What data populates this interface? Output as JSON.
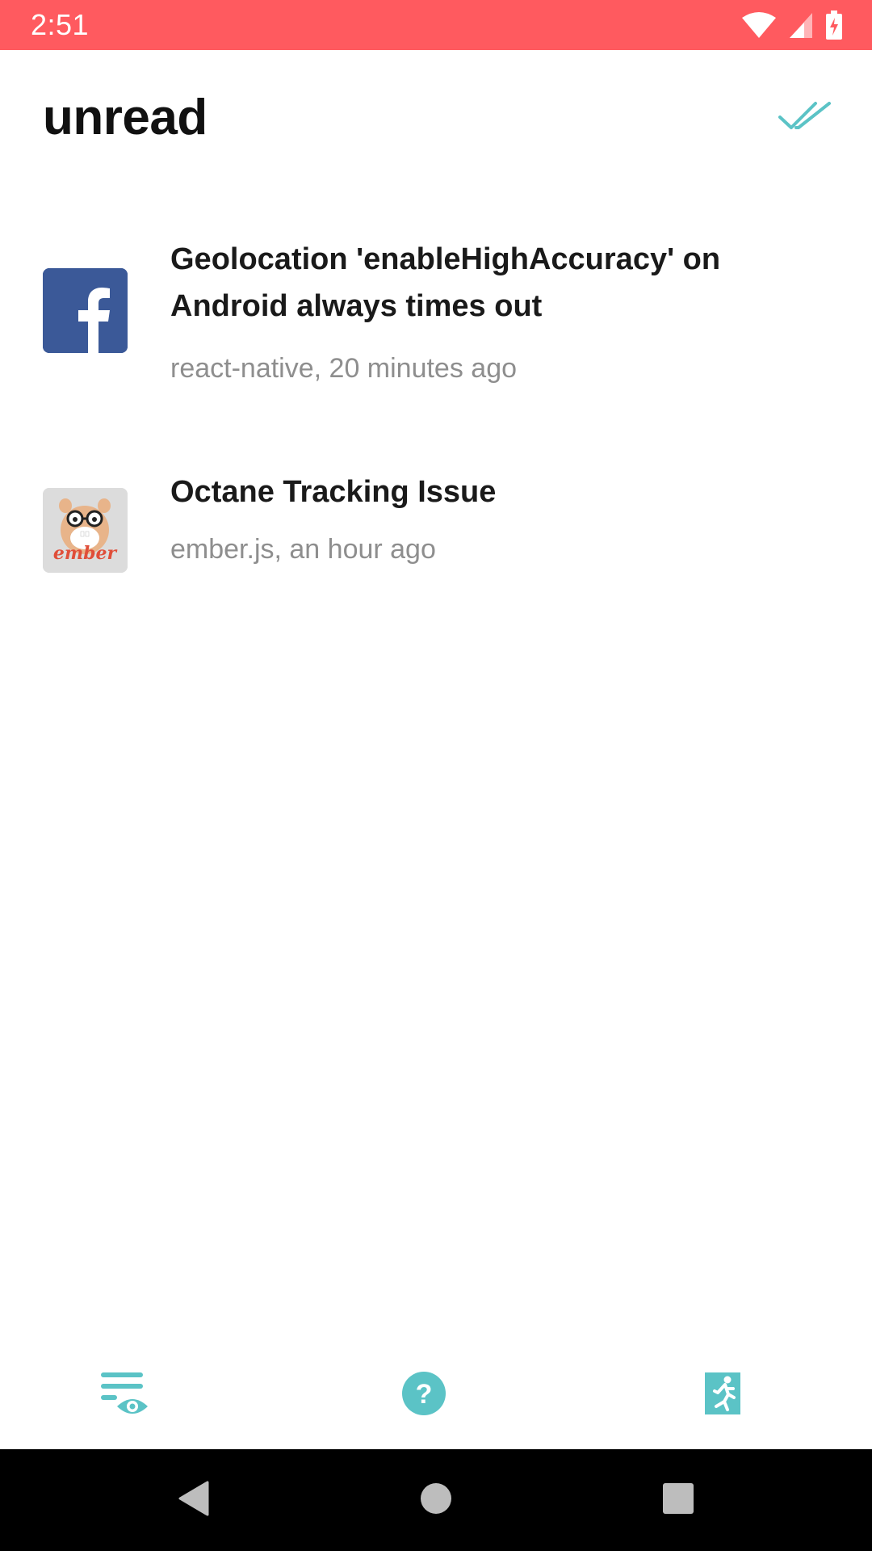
{
  "status_bar": {
    "time": "2:51",
    "icons": [
      "wifi-icon",
      "cell-signal-icon",
      "battery-charging-icon"
    ],
    "color": "#ff5a5f"
  },
  "header": {
    "title": "unread",
    "action_icon": "double-check-icon"
  },
  "notifications": [
    {
      "title": "Geolocation 'enableHighAccuracy' on Android always times out",
      "meta": "react-native, 20 minutes ago",
      "avatar": "facebook-logo"
    },
    {
      "title": "Octane Tracking Issue",
      "meta": "ember.js, an hour ago",
      "avatar": "ember-logo",
      "avatar_text": "ember"
    }
  ],
  "tab_bar": {
    "accent": "#5bc3c6",
    "tabs": [
      {
        "icon": "watching-list-icon"
      },
      {
        "icon": "help-icon"
      },
      {
        "icon": "exit-icon"
      }
    ]
  },
  "nav_bar": {
    "buttons": [
      "back-icon",
      "home-icon",
      "recents-icon"
    ]
  }
}
